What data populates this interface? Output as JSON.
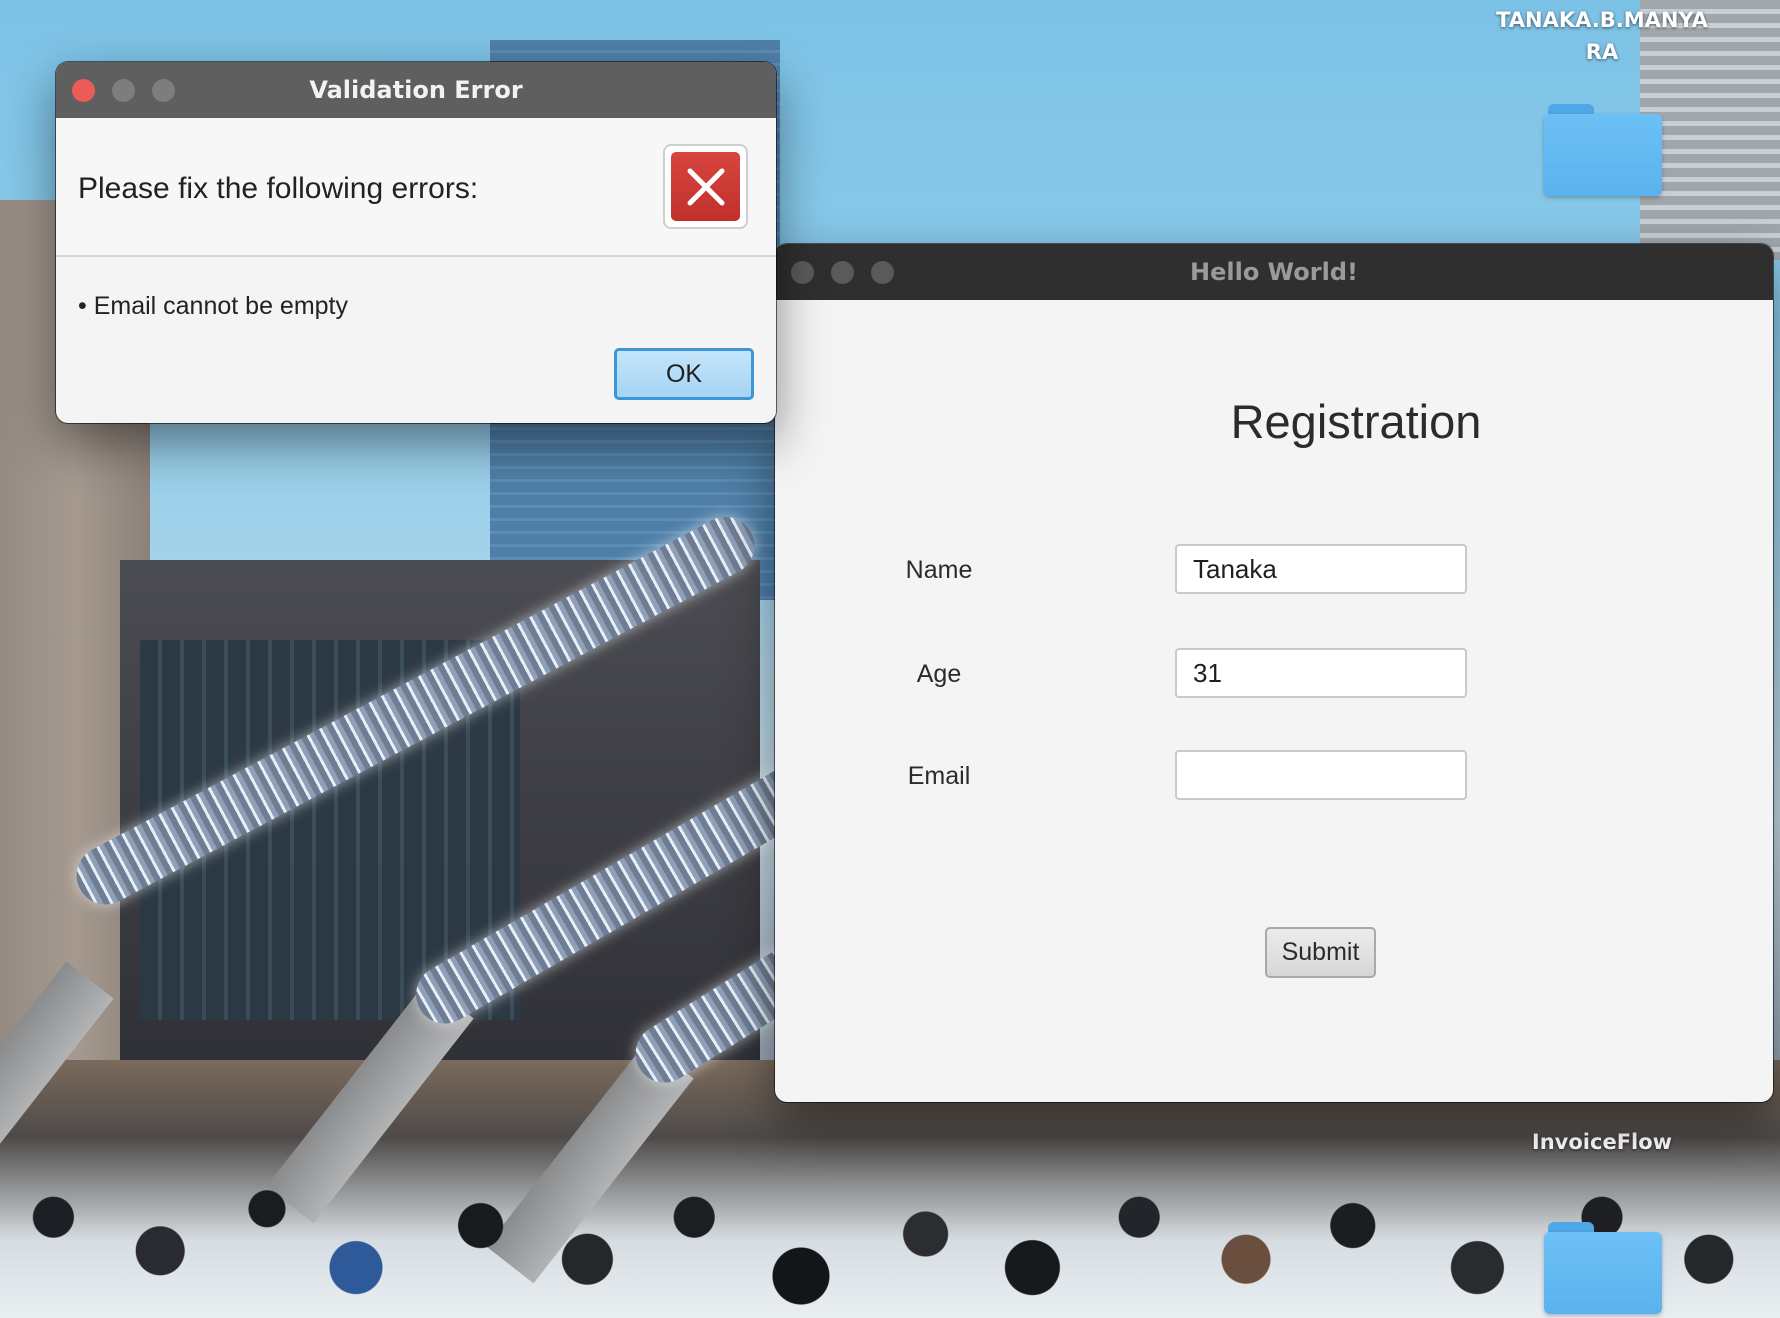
{
  "desktop": {
    "icons": [
      {
        "label_line1": "TANAKA.B.MANYA",
        "label_line2": "RA"
      },
      {
        "label": "InvoiceFlow"
      }
    ]
  },
  "dialog": {
    "title": "Validation Error",
    "header": "Please fix the following errors:",
    "icon": "error-x-icon",
    "errors": [
      "• Email cannot be empty"
    ],
    "ok_label": "OK",
    "colors": {
      "close": "#ec5c57",
      "ok_border": "#3d96d6",
      "error_icon": "#c9362f"
    }
  },
  "window": {
    "title": "Hello World!",
    "heading": "Registration",
    "fields": [
      {
        "label": "Name",
        "value": "Tanaka"
      },
      {
        "label": "Age",
        "value": "31"
      },
      {
        "label": "Email",
        "value": ""
      }
    ],
    "submit_label": "Submit"
  }
}
